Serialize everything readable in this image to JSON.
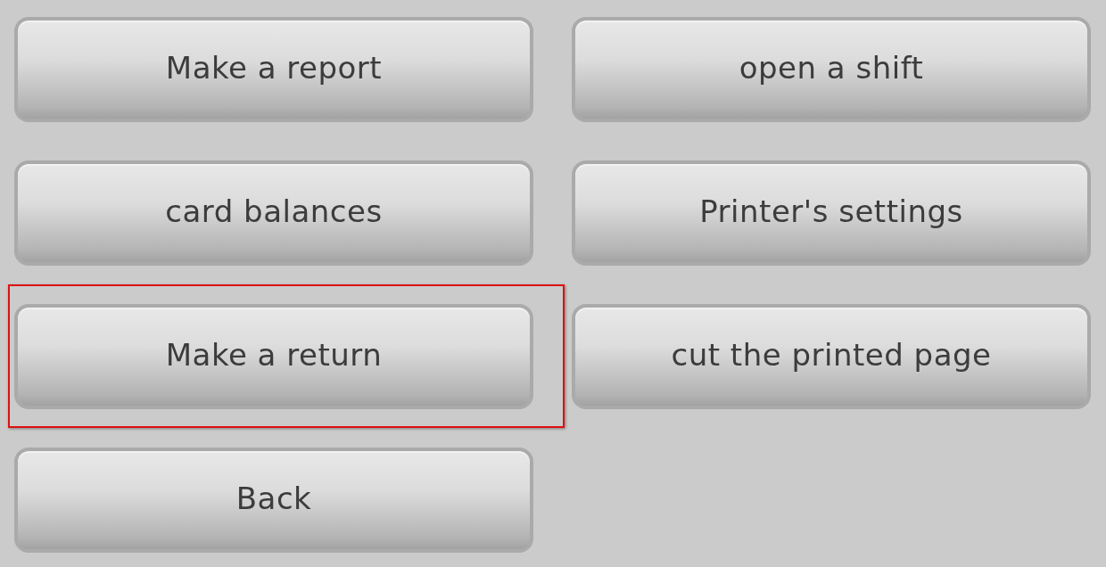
{
  "buttons": [
    {
      "label": "Make a report",
      "selected": false
    },
    {
      "label": "open a shift",
      "selected": false
    },
    {
      "label": "card balances",
      "selected": false
    },
    {
      "label": "Printer's settings",
      "selected": false
    },
    {
      "label": "Make a return",
      "selected": true
    },
    {
      "label": "cut the printed page",
      "selected": false
    },
    {
      "label": "Back",
      "selected": false
    }
  ]
}
